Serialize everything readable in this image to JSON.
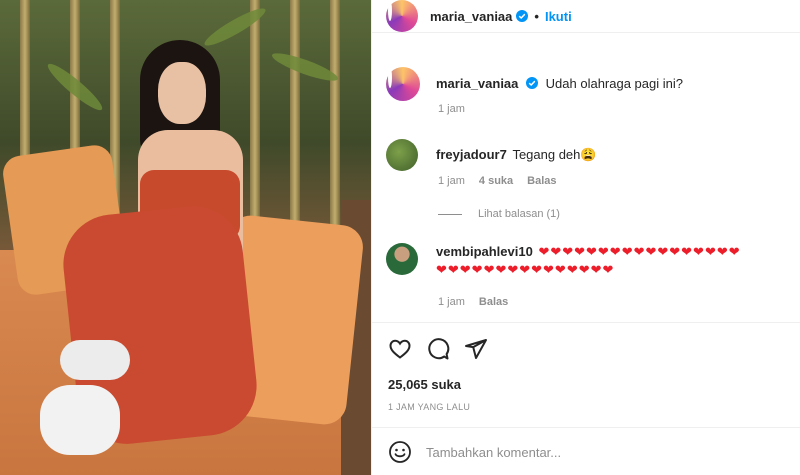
{
  "post": {
    "author": "maria_vaniaa",
    "follow_label": "Ikuti",
    "dot": "•"
  },
  "caption": {
    "username": "maria_vaniaa",
    "text": "Udah olahraga pagi ini?",
    "time": "1 jam"
  },
  "comments": [
    {
      "username": "freyjadour7",
      "text": "Tegang deh😩",
      "time": "1 jam",
      "likes": "4 suka",
      "reply": "Balas",
      "view_replies": "Lihat balasan (1)"
    },
    {
      "username": "vembipahlevi10",
      "line1": "❤❤❤❤❤❤❤❤❤❤❤❤❤❤❤❤❤",
      "line2": "❤❤❤❤❤❤❤❤❤❤❤❤❤❤❤",
      "time": "1 jam",
      "reply": "Balas"
    }
  ],
  "stats": {
    "likes": "25,065 suka",
    "posted": "1 JAM YANG LALU"
  },
  "composer": {
    "placeholder": "Tambahkan komentar..."
  },
  "colors": {
    "accent": "#0095f6",
    "heart": "#ed1d2a",
    "muted": "#8e8e8e"
  },
  "icons": [
    "verified-badge-icon",
    "heart-icon",
    "comment-icon",
    "share-icon",
    "emoji-icon"
  ]
}
